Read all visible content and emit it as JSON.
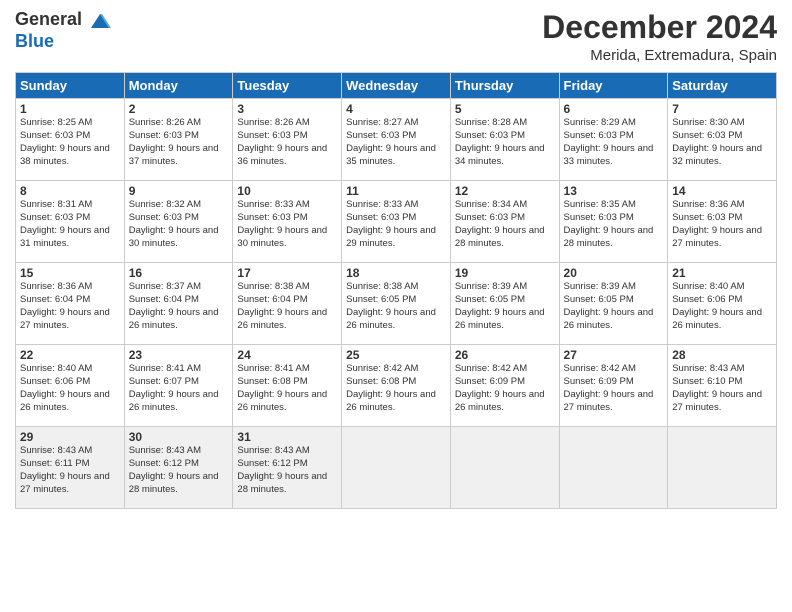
{
  "logo": {
    "general": "General",
    "blue": "Blue"
  },
  "title": "December 2024",
  "location": "Merida, Extremadura, Spain",
  "days_of_week": [
    "Sunday",
    "Monday",
    "Tuesday",
    "Wednesday",
    "Thursday",
    "Friday",
    "Saturday"
  ],
  "weeks": [
    [
      {
        "day": "1",
        "sunrise": "8:25 AM",
        "sunset": "6:03 PM",
        "daylight": "9 hours and 38 minutes."
      },
      {
        "day": "2",
        "sunrise": "8:26 AM",
        "sunset": "6:03 PM",
        "daylight": "9 hours and 37 minutes."
      },
      {
        "day": "3",
        "sunrise": "8:26 AM",
        "sunset": "6:03 PM",
        "daylight": "9 hours and 36 minutes."
      },
      {
        "day": "4",
        "sunrise": "8:27 AM",
        "sunset": "6:03 PM",
        "daylight": "9 hours and 35 minutes."
      },
      {
        "day": "5",
        "sunrise": "8:28 AM",
        "sunset": "6:03 PM",
        "daylight": "9 hours and 34 minutes."
      },
      {
        "day": "6",
        "sunrise": "8:29 AM",
        "sunset": "6:03 PM",
        "daylight": "9 hours and 33 minutes."
      },
      {
        "day": "7",
        "sunrise": "8:30 AM",
        "sunset": "6:03 PM",
        "daylight": "9 hours and 32 minutes."
      }
    ],
    [
      {
        "day": "8",
        "sunrise": "8:31 AM",
        "sunset": "6:03 PM",
        "daylight": "9 hours and 31 minutes."
      },
      {
        "day": "9",
        "sunrise": "8:32 AM",
        "sunset": "6:03 PM",
        "daylight": "9 hours and 30 minutes."
      },
      {
        "day": "10",
        "sunrise": "8:33 AM",
        "sunset": "6:03 PM",
        "daylight": "9 hours and 30 minutes."
      },
      {
        "day": "11",
        "sunrise": "8:33 AM",
        "sunset": "6:03 PM",
        "daylight": "9 hours and 29 minutes."
      },
      {
        "day": "12",
        "sunrise": "8:34 AM",
        "sunset": "6:03 PM",
        "daylight": "9 hours and 28 minutes."
      },
      {
        "day": "13",
        "sunrise": "8:35 AM",
        "sunset": "6:03 PM",
        "daylight": "9 hours and 28 minutes."
      },
      {
        "day": "14",
        "sunrise": "8:36 AM",
        "sunset": "6:03 PM",
        "daylight": "9 hours and 27 minutes."
      }
    ],
    [
      {
        "day": "15",
        "sunrise": "8:36 AM",
        "sunset": "6:04 PM",
        "daylight": "9 hours and 27 minutes."
      },
      {
        "day": "16",
        "sunrise": "8:37 AM",
        "sunset": "6:04 PM",
        "daylight": "9 hours and 26 minutes."
      },
      {
        "day": "17",
        "sunrise": "8:38 AM",
        "sunset": "6:04 PM",
        "daylight": "9 hours and 26 minutes."
      },
      {
        "day": "18",
        "sunrise": "8:38 AM",
        "sunset": "6:05 PM",
        "daylight": "9 hours and 26 minutes."
      },
      {
        "day": "19",
        "sunrise": "8:39 AM",
        "sunset": "6:05 PM",
        "daylight": "9 hours and 26 minutes."
      },
      {
        "day": "20",
        "sunrise": "8:39 AM",
        "sunset": "6:05 PM",
        "daylight": "9 hours and 26 minutes."
      },
      {
        "day": "21",
        "sunrise": "8:40 AM",
        "sunset": "6:06 PM",
        "daylight": "9 hours and 26 minutes."
      }
    ],
    [
      {
        "day": "22",
        "sunrise": "8:40 AM",
        "sunset": "6:06 PM",
        "daylight": "9 hours and 26 minutes."
      },
      {
        "day": "23",
        "sunrise": "8:41 AM",
        "sunset": "6:07 PM",
        "daylight": "9 hours and 26 minutes."
      },
      {
        "day": "24",
        "sunrise": "8:41 AM",
        "sunset": "6:08 PM",
        "daylight": "9 hours and 26 minutes."
      },
      {
        "day": "25",
        "sunrise": "8:42 AM",
        "sunset": "6:08 PM",
        "daylight": "9 hours and 26 minutes."
      },
      {
        "day": "26",
        "sunrise": "8:42 AM",
        "sunset": "6:09 PM",
        "daylight": "9 hours and 26 minutes."
      },
      {
        "day": "27",
        "sunrise": "8:42 AM",
        "sunset": "6:09 PM",
        "daylight": "9 hours and 27 minutes."
      },
      {
        "day": "28",
        "sunrise": "8:43 AM",
        "sunset": "6:10 PM",
        "daylight": "9 hours and 27 minutes."
      }
    ],
    [
      {
        "day": "29",
        "sunrise": "8:43 AM",
        "sunset": "6:11 PM",
        "daylight": "9 hours and 27 minutes."
      },
      {
        "day": "30",
        "sunrise": "8:43 AM",
        "sunset": "6:12 PM",
        "daylight": "9 hours and 28 minutes."
      },
      {
        "day": "31",
        "sunrise": "8:43 AM",
        "sunset": "6:12 PM",
        "daylight": "9 hours and 28 minutes."
      },
      null,
      null,
      null,
      null
    ]
  ]
}
